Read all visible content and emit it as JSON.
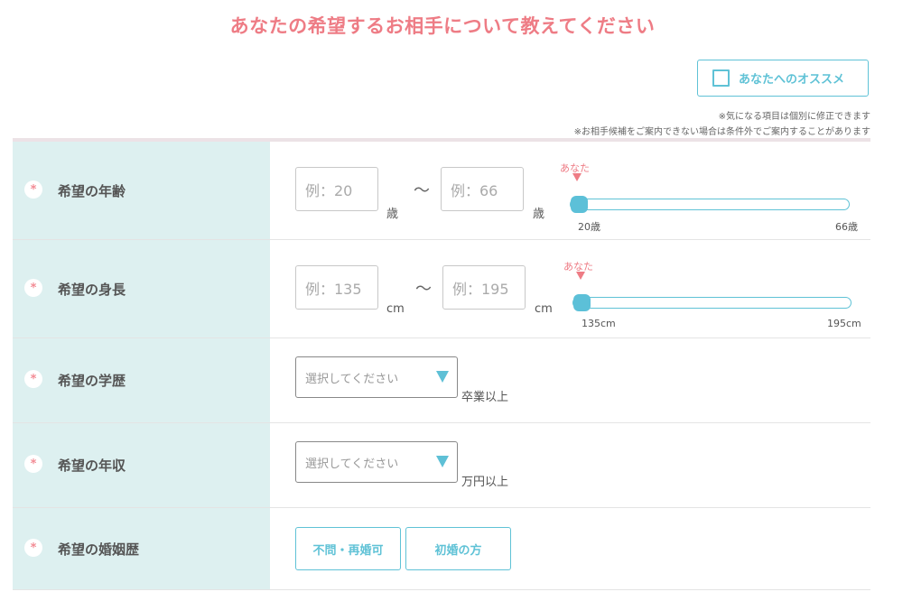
{
  "title": "あなたの希望するお相手について教えてください",
  "recommend_button": {
    "label": "あなたへのオススメ"
  },
  "notes": [
    "※気になる項目は個別に修正できます",
    "※お相手候補をご案内できない場合は条件外でご案内することがあります"
  ],
  "required_mark": "*",
  "rows": {
    "age": {
      "label": "希望の年齢",
      "min_placeholder": "例：20",
      "max_placeholder": "例：66",
      "unit": "歳",
      "tilde": "〜",
      "you_label": "あなた",
      "slider_min_label": "20歳",
      "slider_max_label": "66歳",
      "slider_value": 20
    },
    "height": {
      "label": "希望の身長",
      "min_placeholder": "例：135",
      "max_placeholder": "例：195",
      "unit": "cm",
      "tilde": "〜",
      "you_label": "あなた",
      "slider_min_label": "135cm",
      "slider_max_label": "195cm",
      "slider_value": 135
    },
    "education": {
      "label": "希望の学歴",
      "select_placeholder": "選択してください",
      "suffix": "卒業以上"
    },
    "income": {
      "label": "希望の年収",
      "select_placeholder": "選択してください",
      "suffix": "万円以上"
    },
    "marital": {
      "label": "希望の婚姻歴",
      "options": [
        "不問・再婚可",
        "初婚の方"
      ]
    }
  },
  "colors": {
    "accent_pink": "#ee7c85",
    "accent_teal": "#5fc2d6",
    "label_bg": "#ddf0f0"
  }
}
